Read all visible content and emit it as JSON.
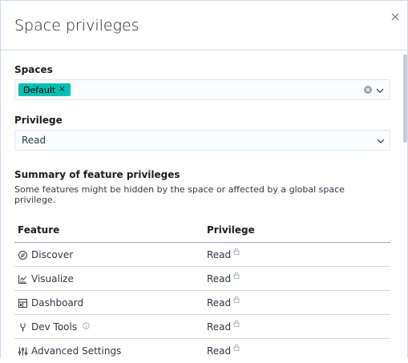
{
  "flyout": {
    "title": "Space privileges",
    "close_icon": "close-icon"
  },
  "spaces": {
    "label": "Spaces",
    "selected": [
      {
        "label": "Default",
        "color": "#00bfb3"
      }
    ],
    "clear_icon": "clear-circle-icon",
    "dropdown_icon": "chevron-down-icon"
  },
  "privilege": {
    "label": "Privilege",
    "value": "Read",
    "dropdown_icon": "chevron-down-icon"
  },
  "summary": {
    "title": "Summary of feature privileges",
    "description": "Some features might be hidden by the space or affected by a global space privilege."
  },
  "table": {
    "columns": [
      "Feature",
      "Privilege"
    ],
    "rows": [
      {
        "feature": "Discover",
        "icon": "compass-icon",
        "privilege": "Read",
        "info": false
      },
      {
        "feature": "Visualize",
        "icon": "visualize-icon",
        "privilege": "Read",
        "info": false
      },
      {
        "feature": "Dashboard",
        "icon": "dashboard-icon",
        "privilege": "Read",
        "info": false
      },
      {
        "feature": "Dev Tools",
        "icon": "dev-tools-icon",
        "privilege": "Read",
        "info": true
      },
      {
        "feature": "Advanced Settings",
        "icon": "advanced-settings-icon",
        "privilege": "Read",
        "info": false
      }
    ]
  },
  "colors": {
    "accent": "#00bfb3",
    "border": "#d3dae6",
    "text": "#343741"
  }
}
